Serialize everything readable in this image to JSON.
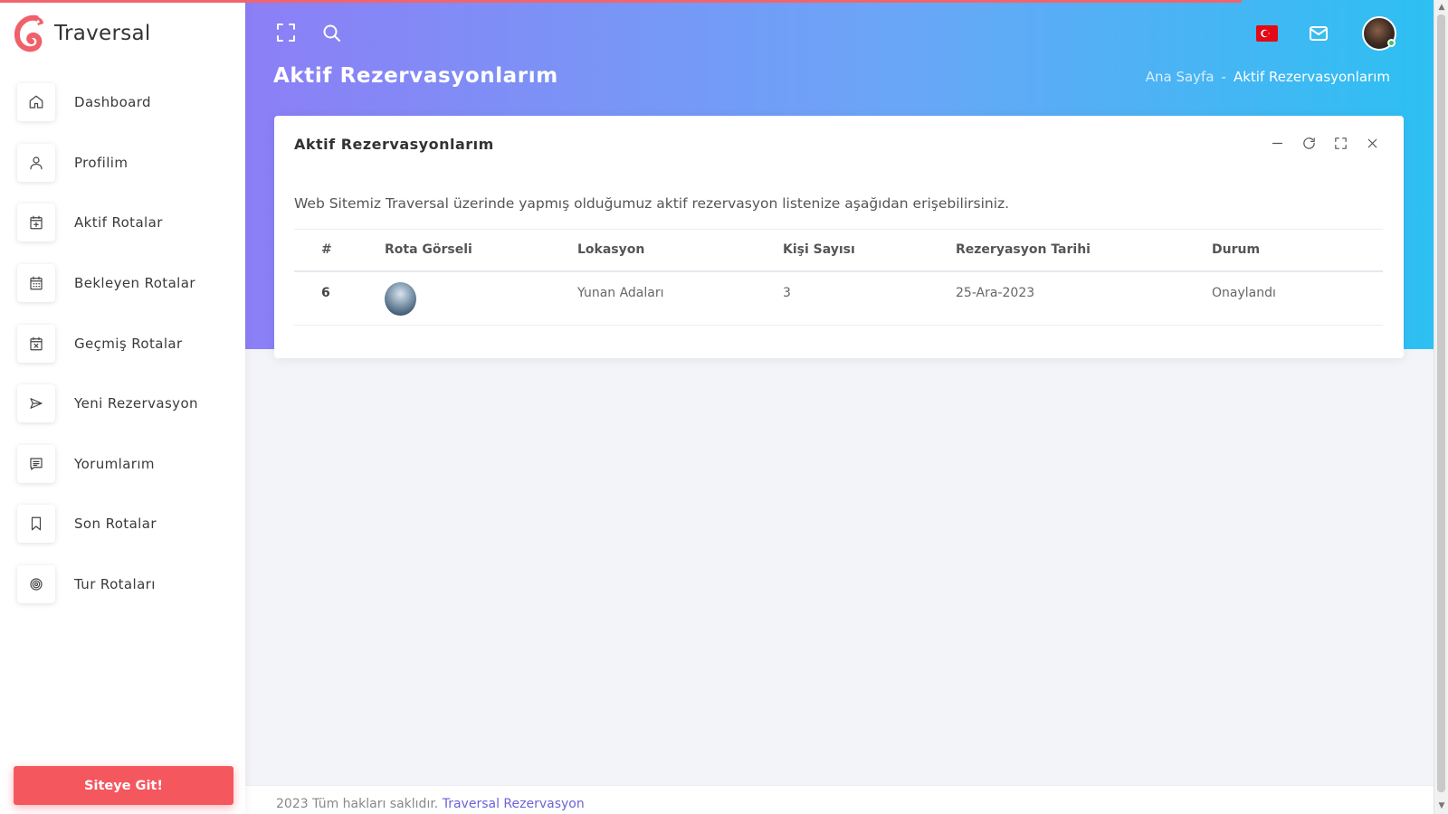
{
  "app": {
    "name": "Traversal"
  },
  "sidebar": {
    "items": [
      {
        "label": "Dashboard",
        "icon": "home-icon"
      },
      {
        "label": "Profilim",
        "icon": "user-icon"
      },
      {
        "label": "Aktif Rotalar",
        "icon": "calendar-plus-icon"
      },
      {
        "label": "Bekleyen Rotalar",
        "icon": "calendar-icon"
      },
      {
        "label": "Geçmiş Rotalar",
        "icon": "calendar-x-icon"
      },
      {
        "label": "Yeni Rezervasyon",
        "icon": "send-icon"
      },
      {
        "label": "Yorumlarım",
        "icon": "message-icon"
      },
      {
        "label": "Son Rotalar",
        "icon": "bookmark-icon"
      },
      {
        "label": "Tur Rotaları",
        "icon": "target-icon"
      }
    ],
    "site_button": "Siteye Git!"
  },
  "header": {
    "page_title": "Aktif Rezervasyonlarım",
    "breadcrumb": {
      "home": "Ana Sayfa",
      "separator": "-",
      "current": "Aktif Rezervasyonlarım"
    }
  },
  "card": {
    "title": "Aktif Rezervasyonlarım",
    "description": "Web Sitemiz Traversal üzerinde yapmış olduğumuz aktif rezervasyon listenize aşağıdan erişebilirsiniz.",
    "columns": [
      "#",
      "Rota Görseli",
      "Lokasyon",
      "Kişi Sayısı",
      "Rezeryasyon Tarihi",
      "Durum"
    ],
    "rows": [
      {
        "id": "6",
        "image": "route-thumbnail",
        "location": "Yunan Adaları",
        "people": "3",
        "date": "25-Ara-2023",
        "status": "Onaylandı"
      }
    ]
  },
  "footer": {
    "text": "2023 Tüm hakları saklıdır.",
    "link": "Traversal Rezervasyon"
  },
  "colors": {
    "accent": "#f5575f",
    "gradient_start": "#8c7ff6",
    "gradient_end": "#2dc0f2",
    "link": "#6a63d8"
  }
}
